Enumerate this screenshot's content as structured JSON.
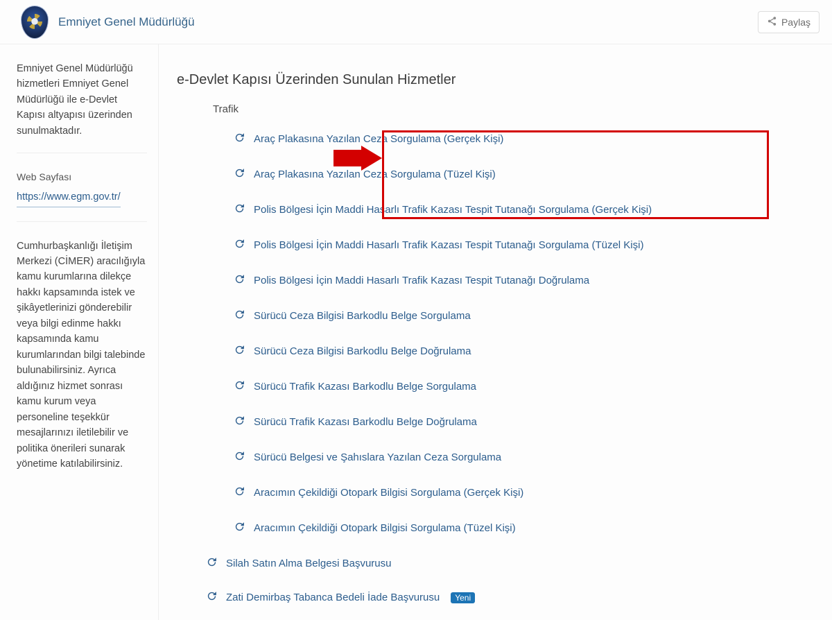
{
  "header": {
    "institution": "Emniyet Genel Müdürlüğü",
    "share_label": "Paylaş"
  },
  "sidebar": {
    "intro": "Emniyet Genel Müdürlüğü hizmetleri Emniyet Genel Müdürlüğü ile e-Devlet Kapısı altyapısı üzerinden sunulmaktadır.",
    "web_label": "Web Sayfası",
    "web_url": "https://www.egm.gov.tr/",
    "cimer": "Cumhurbaşkanlığı İletişim Merkezi (CİMER) aracılığıyla kamu kurumlarına dilekçe hakkı kapsamında istek ve şikâyetlerinizi gönderebilir veya bilgi edinme hakkı kapsamında kamu kurumlarından bilgi talebinde bulunabilirsiniz. Ayrıca aldığınız hizmet sonrası kamu kurum veya personeline teşekkür mesajlarınızı iletilebilir ve politika önerileri sunarak yönetime katılabilirsiniz."
  },
  "main": {
    "title": "e-Devlet Kapısı Üzerinden Sunulan Hizmetler",
    "section": "Trafik",
    "services": [
      "Araç Plakasına Yazılan Ceza Sorgulama (Gerçek Kişi)",
      "Araç Plakasına Yazılan Ceza Sorgulama (Tüzel Kişi)",
      "Polis Bölgesi İçin Maddi Hasarlı Trafik Kazası Tespit Tutanağı Sorgulama (Gerçek Kişi)",
      "Polis Bölgesi İçin Maddi Hasarlı Trafik Kazası Tespit Tutanağı Sorgulama (Tüzel Kişi)",
      "Polis Bölgesi İçin Maddi Hasarlı Trafik Kazası Tespit Tutanağı Doğrulama",
      "Sürücü Ceza Bilgisi Barkodlu Belge Sorgulama",
      "Sürücü Ceza Bilgisi Barkodlu Belge Doğrulama",
      "Sürücü Trafik Kazası Barkodlu Belge Sorgulama",
      "Sürücü Trafik Kazası Barkodlu Belge Doğrulama",
      "Sürücü Belgesi ve Şahıslara Yazılan Ceza Sorgulama",
      "Aracımın Çekildiği Otopark Bilgisi Sorgulama (Gerçek Kişi)",
      "Aracımın Çekildiği Otopark Bilgisi Sorgulama (Tüzel Kişi)"
    ],
    "extra": [
      {
        "label": "Silah Satın Alma Belgesi Başvurusu",
        "badge": ""
      },
      {
        "label": "Zati Demirbaş Tabanca Bedeli İade Başvurusu",
        "badge": "Yeni"
      }
    ]
  }
}
